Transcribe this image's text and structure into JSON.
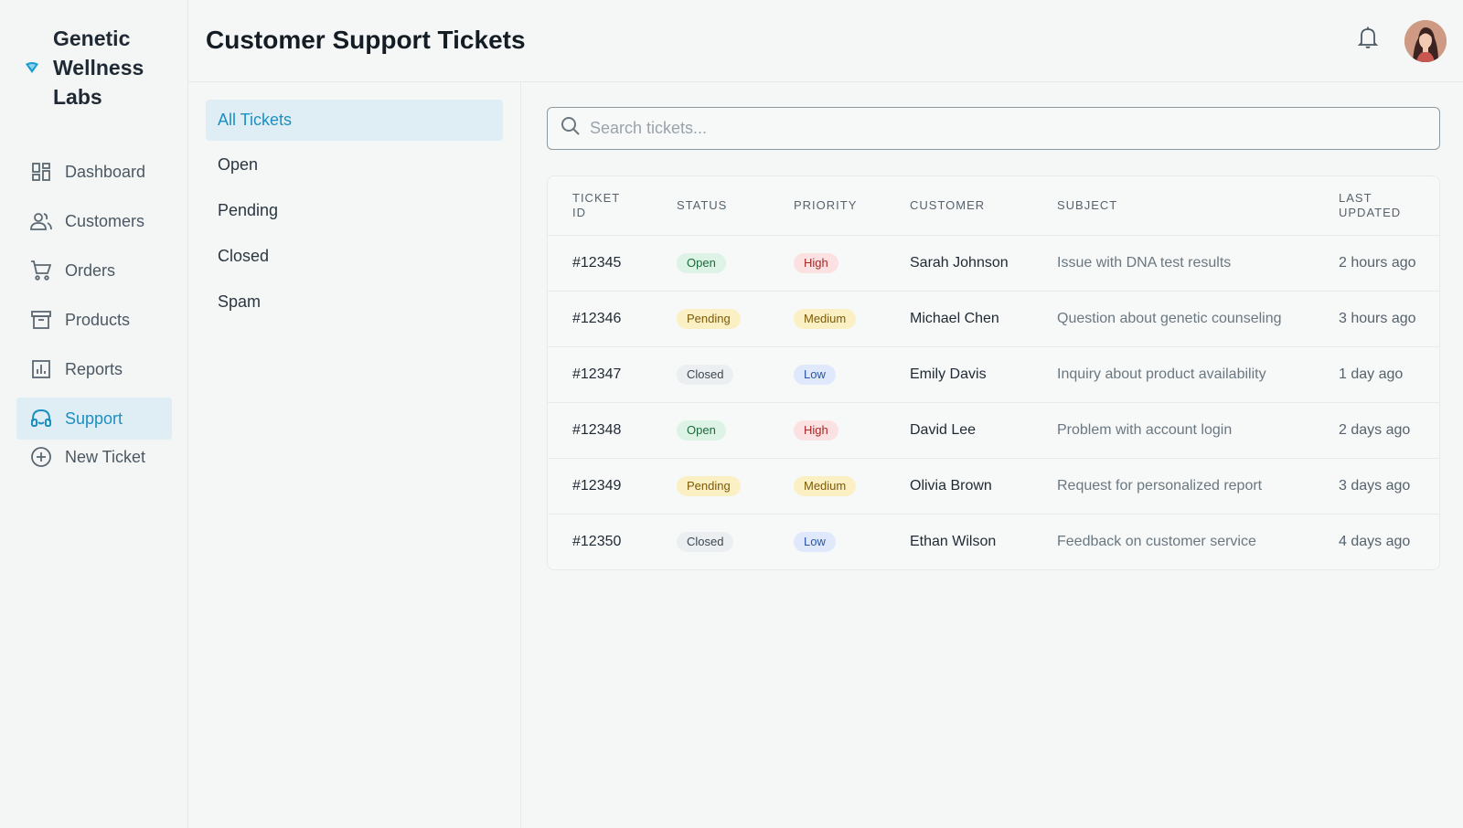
{
  "brand": {
    "name": "Genetic Wellness Labs"
  },
  "nav": {
    "items": [
      {
        "label": "Dashboard",
        "icon": "dashboard-icon"
      },
      {
        "label": "Customers",
        "icon": "users-icon"
      },
      {
        "label": "Orders",
        "icon": "cart-icon"
      },
      {
        "label": "Products",
        "icon": "archive-icon"
      },
      {
        "label": "Reports",
        "icon": "bar-chart-icon"
      },
      {
        "label": "Support",
        "icon": "headset-icon",
        "active": true
      },
      {
        "label": "New Ticket",
        "icon": "plus-circle-icon"
      }
    ]
  },
  "header": {
    "title": "Customer Support Tickets"
  },
  "filters": [
    "All Tickets",
    "Open",
    "Pending",
    "Closed",
    "Spam"
  ],
  "search": {
    "placeholder": "Search tickets..."
  },
  "table": {
    "columns": [
      "TICKET ID",
      "STATUS",
      "PRIORITY",
      "CUSTOMER",
      "SUBJECT",
      "LAST UPDATED"
    ],
    "rows": [
      {
        "id": "#12345",
        "status": "Open",
        "priority": "High",
        "customer": "Sarah Johnson",
        "subject": "Issue with DNA test results",
        "updated": "2 hours ago"
      },
      {
        "id": "#12346",
        "status": "Pending",
        "priority": "Medium",
        "customer": "Michael Chen",
        "subject": "Question about genetic counseling",
        "updated": "3 hours ago"
      },
      {
        "id": "#12347",
        "status": "Closed",
        "priority": "Low",
        "customer": "Emily Davis",
        "subject": "Inquiry about product availability",
        "updated": "1 day ago"
      },
      {
        "id": "#12348",
        "status": "Open",
        "priority": "High",
        "customer": "David Lee",
        "subject": "Problem with account login",
        "updated": "2 days ago"
      },
      {
        "id": "#12349",
        "status": "Pending",
        "priority": "Medium",
        "customer": "Olivia Brown",
        "subject": "Request for personalized report",
        "updated": "3 days ago"
      },
      {
        "id": "#12350",
        "status": "Closed",
        "priority": "Low",
        "customer": "Ethan Wilson",
        "subject": "Feedback on customer service",
        "updated": "4 days ago"
      }
    ]
  },
  "colors": {
    "accent": "#1b8fc1",
    "active_bg": "#dfeef4"
  }
}
